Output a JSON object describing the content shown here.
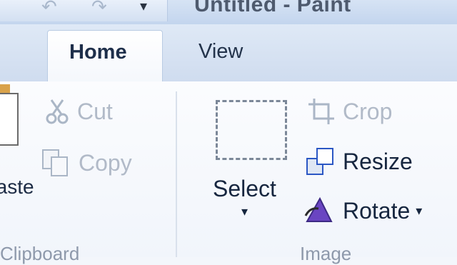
{
  "window": {
    "title": "Untitled - Paint"
  },
  "quick_access": {
    "undo_icon": "undo-icon",
    "redo_icon": "redo-icon",
    "dropdown_glyph": "▾"
  },
  "tabs": [
    {
      "label": "Home",
      "active": true
    },
    {
      "label": "View",
      "active": false
    }
  ],
  "groups": {
    "clipboard": {
      "label": "Clipboard",
      "paste_label": "Paste",
      "cut_label": "Cut",
      "copy_label": "Copy"
    },
    "image": {
      "label": "Image",
      "select_label": "Select",
      "crop_label": "Crop",
      "resize_label": "Resize",
      "rotate_label": "Rotate"
    }
  },
  "colors": {
    "accent": "#2b57c4",
    "disabled": "#b1bac8",
    "text": "#16263f"
  }
}
